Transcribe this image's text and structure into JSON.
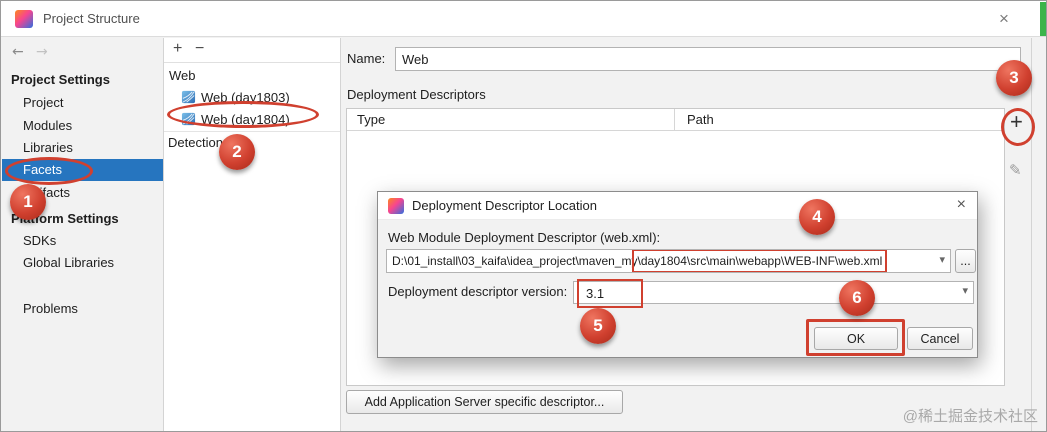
{
  "window": {
    "title": "Project Structure",
    "close_glyph": "×",
    "back_glyph": "←",
    "forward_glyph": "→"
  },
  "colors": {
    "accent": "#d0402f",
    "selection": "#2675bf",
    "green": "#3cb44a"
  },
  "sidebar": {
    "sections": [
      {
        "header": "Project Settings",
        "items": [
          {
            "label": "Project"
          },
          {
            "label": "Modules"
          },
          {
            "label": "Libraries"
          },
          {
            "label": "Facets"
          },
          {
            "label": "Artifacts"
          }
        ]
      },
      {
        "header": "Platform Settings",
        "items": [
          {
            "label": "SDKs"
          },
          {
            "label": "Global Libraries"
          }
        ]
      }
    ],
    "problems_label": "Problems"
  },
  "tree": {
    "add_glyph": "+",
    "remove_glyph": "−",
    "root_label": "Web",
    "items": [
      {
        "label": "Web (day1803)"
      },
      {
        "label": "Web (day1804)"
      }
    ],
    "detection_label": "Detection"
  },
  "main": {
    "name_label": "Name:",
    "name_value": "Web",
    "section_title": "Deployment Descriptors",
    "columns": {
      "type": "Type",
      "path": "Path"
    },
    "add_glyph": "+",
    "edit_glyph": "✎",
    "add_server_button": "Add Application Server specific descriptor..."
  },
  "dialog": {
    "title": "Deployment Descriptor Location",
    "close_glyph": "×",
    "web_xml_label": "Web Module Deployment Descriptor (web.xml):",
    "path_prefix": "D:\\01_install\\03_kaifa\\idea_project\\maven_my",
    "path_highlight": "\\day1804\\src\\main\\webapp\\WEB-INF\\web.xml",
    "version_label": "Deployment descriptor version:",
    "version_value": "3.1",
    "browse_label": "...",
    "ok_label": "OK",
    "cancel_label": "Cancel",
    "chevron_glyph": "▾"
  },
  "annotations": {
    "badges": [
      {
        "num": "1"
      },
      {
        "num": "2"
      },
      {
        "num": "3"
      },
      {
        "num": "4"
      },
      {
        "num": "5"
      },
      {
        "num": "6"
      }
    ]
  },
  "watermark": "@稀土掘金技术社区"
}
